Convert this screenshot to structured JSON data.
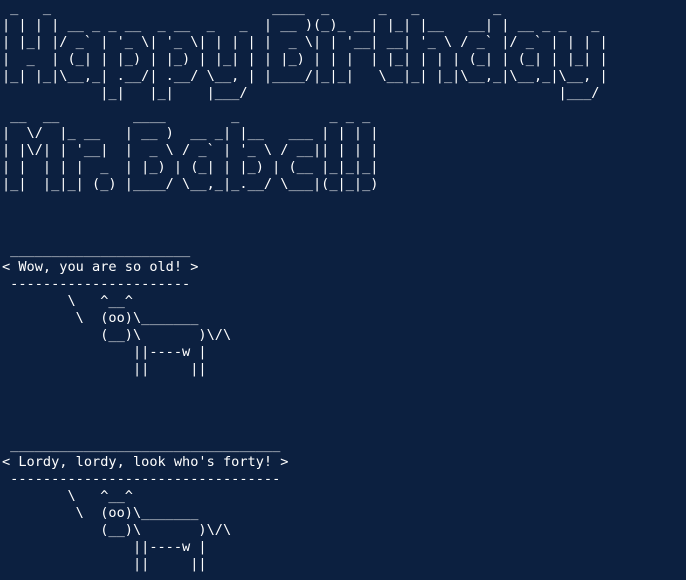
{
  "colors": {
    "background": "#0c2040",
    "foreground": "#ffffff"
  },
  "banner": {
    "line1": {
      "rows": [
        " _   _                           ____  _      _   _         _             ",
        "| | | | __ _ _ __  _ __  _   _  | __ )(_)_ __| |_| |__   __| | __ _ _   _ ",
        "| |_| |/ _` | '_ \\| '_ \\| | | | |  _ \\| | '__| __| '_ \\ / _` |/ _` | | | |",
        "|  _  | (_| | |_) | |_) | |_| | | |_) | | |  | |_| | | | (_| | (_| | |_| |",
        "|_| |_|\\__,_| .__/| .__/ \\__, | |____/|_|_|   \\__|_| |_|\\__,_|\\__,_|\\__, |",
        "            |_|   |_|    |___/                                      |___/ "
      ]
    },
    "line2": {
      "rows": [
        " __  __         ____        _           _ _ _ ",
        "|  \\/  |_ __   | __ )  __ _| |__   ___ | | | |",
        "| |\\/| | '__|  |  _ \\ / _` | '_ \\ / __|| | | |",
        "| |  | | |  _  | |_) | (_| | |_) | (__ |_|_|_|",
        "|_|  |_|_| (_) |____/ \\__,_|_.__/ \\___|(_|_|_)"
      ]
    }
  },
  "cowsay_1": {
    "bubble_top": " ______________________ ",
    "message": "< Wow, you are so old! >",
    "bubble_bottom": " ---------------------- ",
    "cow": [
      "        \\   ^__^",
      "         \\  (oo)\\_______",
      "            (__)\\       )\\/\\",
      "                ||----w |",
      "                ||     ||"
    ]
  },
  "cowsay_2": {
    "bubble_top": " _________________________________ ",
    "message": "< Lordy, lordy, look who's forty! >",
    "bubble_bottom": " --------------------------------- ",
    "cow": [
      "        \\   ^__^",
      "         \\  (oo)\\_______",
      "            (__)\\       )\\/\\",
      "                ||----w |",
      "                ||     ||"
    ]
  }
}
